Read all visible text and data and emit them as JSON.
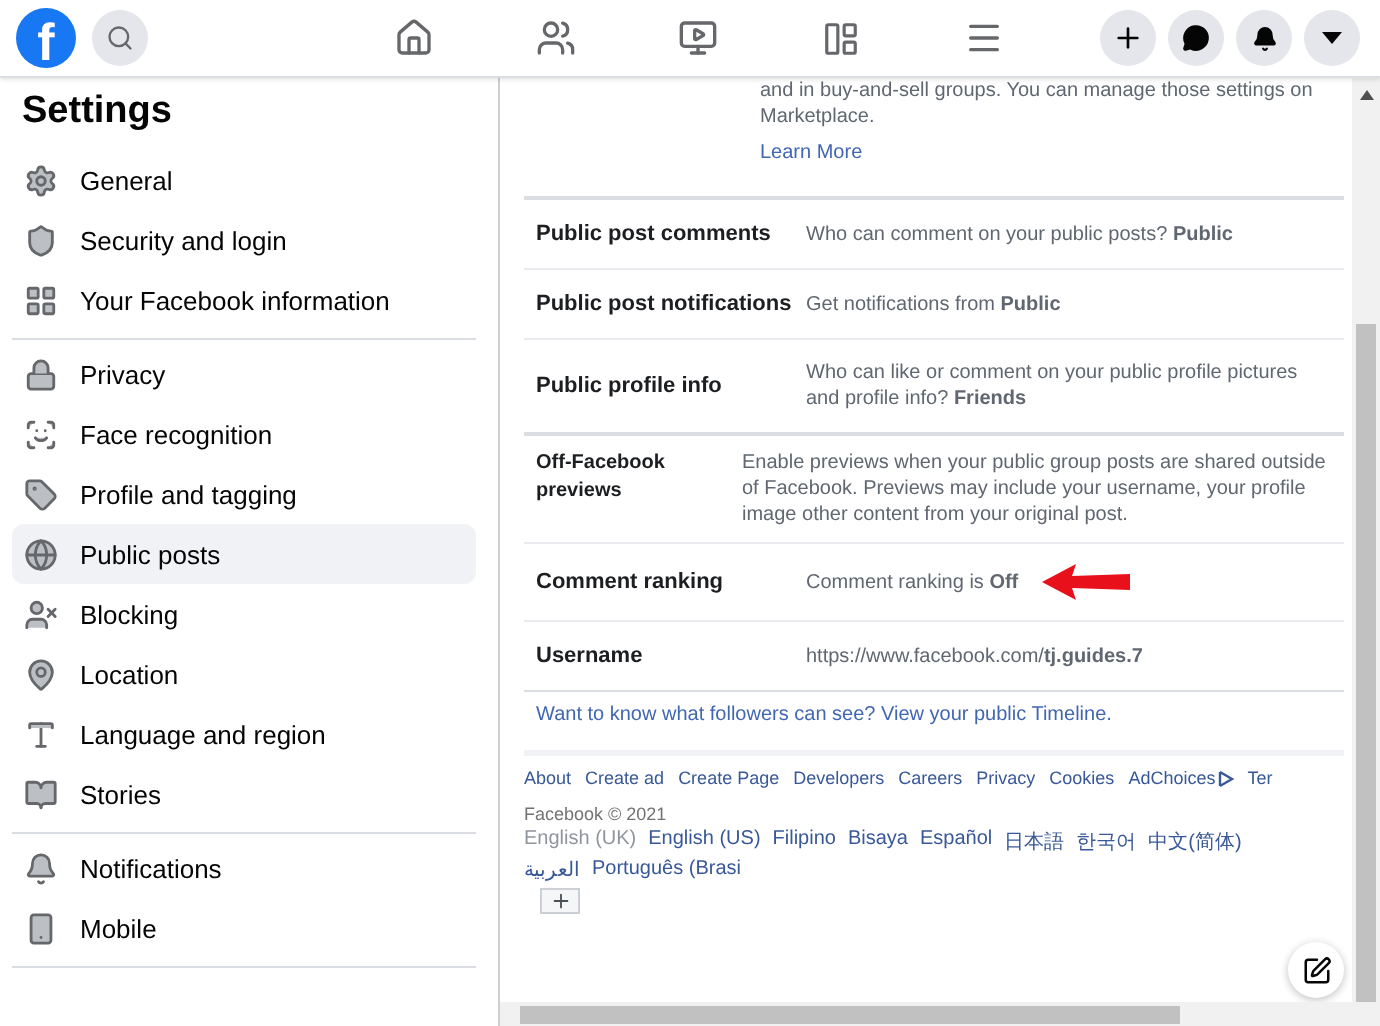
{
  "topbar": {
    "logo": "f"
  },
  "sidebar": {
    "title": "Settings",
    "sections": [
      {
        "items": [
          {
            "label": "General",
            "selected": false
          },
          {
            "label": "Security and login",
            "selected": false
          },
          {
            "label": "Your Facebook information",
            "selected": false
          }
        ]
      },
      {
        "items": [
          {
            "label": "Privacy",
            "selected": false
          },
          {
            "label": "Face recognition",
            "selected": false
          },
          {
            "label": "Profile and tagging",
            "selected": false
          },
          {
            "label": "Public posts",
            "selected": true
          },
          {
            "label": "Blocking",
            "selected": false
          },
          {
            "label": "Location",
            "selected": false
          },
          {
            "label": "Language and region",
            "selected": false
          },
          {
            "label": "Stories",
            "selected": false
          }
        ]
      },
      {
        "items": [
          {
            "label": "Notifications",
            "selected": false
          },
          {
            "label": "Mobile",
            "selected": false
          }
        ]
      }
    ]
  },
  "intro": {
    "text": "and in buy-and-sell groups. You can manage those settings on Marketplace.",
    "link": "Learn More"
  },
  "settings_rows": [
    {
      "kind": "standard",
      "label": "Public post comments",
      "text": "Who can comment on your public posts? **Public**",
      "arrow": false
    },
    {
      "kind": "standard",
      "label": "Public post notifications",
      "text": "Get notifications from **Public**",
      "arrow": false
    },
    {
      "kind": "standard",
      "label": "Public profile info",
      "text": "Who can like or comment on your public profile pictures and profile info? **Friends**",
      "arrow": false
    },
    {
      "kind": "compact",
      "label": "Off-Facebook previews",
      "text": "Enable previews when your public group posts are shared outside of Facebook. Previews may include your username, your profile image other content from your original post.",
      "arrow": false
    },
    {
      "kind": "standard",
      "label": "Comment ranking",
      "text": "Comment ranking is **Off**",
      "arrow": true
    },
    {
      "kind": "standard",
      "label": "Username",
      "text": "https://www.facebook.com/**tj.guides.7**",
      "arrow": false
    }
  ],
  "timeline_prompt": "Want to know what followers can see? View your public Timeline.",
  "footer": {
    "links": [
      "About",
      "Create ad",
      "Create Page",
      "Developers",
      "Careers",
      "Privacy",
      "Cookies",
      "AdChoices",
      "Ter"
    ],
    "copyright": "Facebook © 2021",
    "languages": [
      {
        "label": "English (UK)",
        "selected": true
      },
      {
        "label": "English (US)",
        "selected": false
      },
      {
        "label": "Filipino",
        "selected": false
      },
      {
        "label": "Bisaya",
        "selected": false
      },
      {
        "label": "Español",
        "selected": false
      },
      {
        "label": "日本語",
        "selected": false
      },
      {
        "label": "한국어",
        "selected": false
      },
      {
        "label": "中文(简体)",
        "selected": false
      },
      {
        "label": "العربية",
        "selected": false
      },
      {
        "label": "Português (Brasi",
        "selected": false
      }
    ]
  }
}
